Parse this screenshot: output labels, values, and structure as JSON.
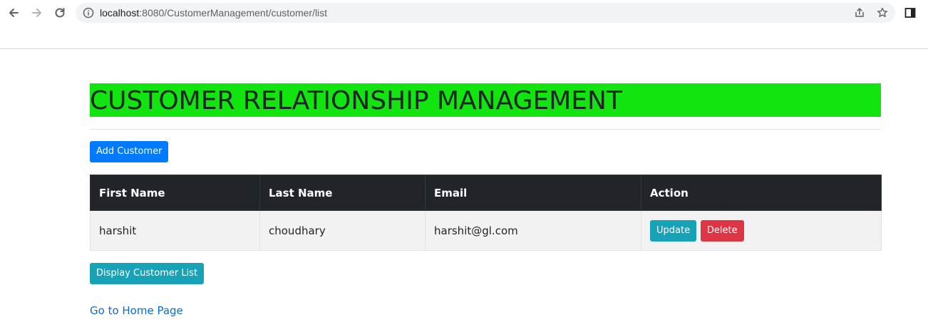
{
  "browser": {
    "url_host": "localhost",
    "url_path": ":8080/CustomerManagement/customer/list"
  },
  "page": {
    "heading": "CUSTOMER RELATIONSHIP MANAGEMENT",
    "add_button": "Add Customer",
    "display_button": "Display Customer List",
    "home_link": "Go to Home Page"
  },
  "table": {
    "headers": [
      "First Name",
      "Last Name",
      "Email",
      "Action"
    ],
    "rows": [
      {
        "first_name": "harshit",
        "last_name": "choudhary",
        "email": "harshit@gl.com",
        "update_label": "Update",
        "delete_label": "Delete"
      }
    ]
  },
  "colors": {
    "heading_bg": "#11e40f",
    "primary": "#007bff",
    "info": "#17a2b8",
    "danger": "#dc3545",
    "table_header_bg": "#212529"
  }
}
